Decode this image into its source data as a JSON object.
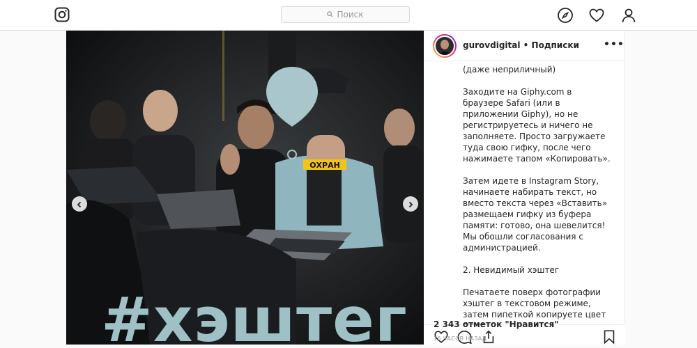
{
  "nav": {
    "search_placeholder": "Поиск"
  },
  "post": {
    "overlay_text": "#хэштег",
    "shirt_text": "ОХРАН"
  },
  "author": {
    "username": "gurovdigital",
    "separator": "•",
    "follow_label": "Подписки",
    "more_label": "•••"
  },
  "caption": {
    "paragraphs": [
      "(даже неприличный)",
      "Заходите на Giphy.com в браузере Safari (или в приложении Giphy), но не регистрируетесь и ничего не заполняете. Просто загружаете туда свою гифку, после чего нажимаете тапом «Копировать».",
      "Затем идете в Instagram Story, начинаете набирать текст, но вместо текста через «Вставить» размещаем гифку из буфера памяти: готово, она шевелится! Мы обошли согласования с администрацией.",
      "2. Невидимый хэштег",
      "Печатаете поверх фотографии хэштег в текстовом режиме, затем пипеткой копируете цвет фона,"
    ]
  },
  "stats": {
    "likes": "2 343 отметок \"Нравится\"",
    "time": "16 ЧАСОВ НАЗАД"
  },
  "colors": {
    "overlay_text": "#9fc1c5",
    "pin": "#a8c6cb",
    "border": "#dbdbdb"
  },
  "icons": [
    "instagram-logo-icon",
    "search-icon",
    "compass-icon",
    "heart-icon",
    "profile-icon",
    "chevron-left-icon",
    "chevron-right-icon",
    "comment-icon",
    "share-icon",
    "bookmark-icon",
    "more-icon"
  ]
}
